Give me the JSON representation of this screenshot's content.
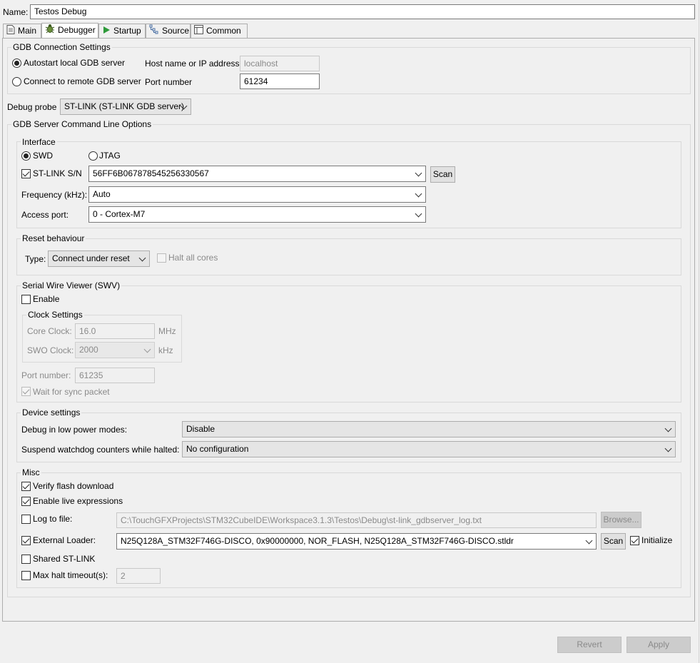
{
  "config": {
    "name_label": "Name:",
    "name_value": "Testos Debug"
  },
  "tabs": [
    {
      "label": "Main",
      "icon": "document-icon"
    },
    {
      "label": "Debugger",
      "icon": "bug-icon"
    },
    {
      "label": "Startup",
      "icon": "play-icon"
    },
    {
      "label": "Source",
      "icon": "source-icon"
    },
    {
      "label": "Common",
      "icon": "common-icon"
    }
  ],
  "gdb_connection": {
    "title": "GDB Connection Settings",
    "autostart_label": "Autostart local GDB server",
    "remote_label": "Connect to remote GDB server",
    "host_label": "Host name or IP address",
    "host_value": "localhost",
    "port_label": "Port number",
    "port_value": "61234"
  },
  "debug_probe": {
    "label": "Debug probe",
    "value": "ST-LINK (ST-LINK GDB server)"
  },
  "gdb_server": {
    "title": "GDB Server Command Line Options",
    "interface": {
      "title": "Interface",
      "swd_label": "SWD",
      "jtag_label": "JTAG",
      "stlink_sn_label": "ST-LINK S/N",
      "stlink_sn_value": "56FF6B067878545256330567",
      "scan_label": "Scan",
      "frequency_label": "Frequency (kHz):",
      "frequency_value": "Auto",
      "access_port_label": "Access port:",
      "access_port_value": "0 - Cortex-M7"
    },
    "reset": {
      "title": "Reset behaviour",
      "type_label": "Type:",
      "type_value": "Connect under reset",
      "halt_all_label": "Halt all cores"
    },
    "swv": {
      "title": "Serial Wire Viewer (SWV)",
      "enable_label": "Enable",
      "clock_title": "Clock Settings",
      "core_clock_label": "Core Clock:",
      "core_clock_value": "16.0",
      "core_clock_unit": "MHz",
      "swo_clock_label": "SWO Clock:",
      "swo_clock_value": "2000",
      "swo_clock_unit": "kHz",
      "port_label": "Port number:",
      "port_value": "61235",
      "wait_sync_label": "Wait for sync packet"
    },
    "device": {
      "title": "Device settings",
      "low_power_label": "Debug in low power modes:",
      "low_power_value": "Disable",
      "watchdog_label": "Suspend watchdog counters while halted:",
      "watchdog_value": "No configuration"
    },
    "misc": {
      "title": "Misc",
      "verify_flash_label": "Verify flash download",
      "live_expr_label": "Enable live expressions",
      "log_file_label": "Log to file:",
      "log_file_value": "C:\\TouchGFXProjects\\STM32CubeIDE\\Workspace3.1.3\\Testos\\Debug\\st-link_gdbserver_log.txt",
      "browse_label": "Browse...",
      "ext_loader_label": "External Loader:",
      "ext_loader_value": "N25Q128A_STM32F746G-DISCO, 0x90000000, NOR_FLASH, N25Q128A_STM32F746G-DISCO.stldr",
      "scan_label": "Scan",
      "initialize_label": "Initialize",
      "shared_stlink_label": "Shared ST-LINK",
      "max_halt_label": "Max halt timeout(s):",
      "max_halt_value": "2"
    }
  },
  "footer": {
    "revert_label": "Revert",
    "apply_label": "Apply"
  }
}
